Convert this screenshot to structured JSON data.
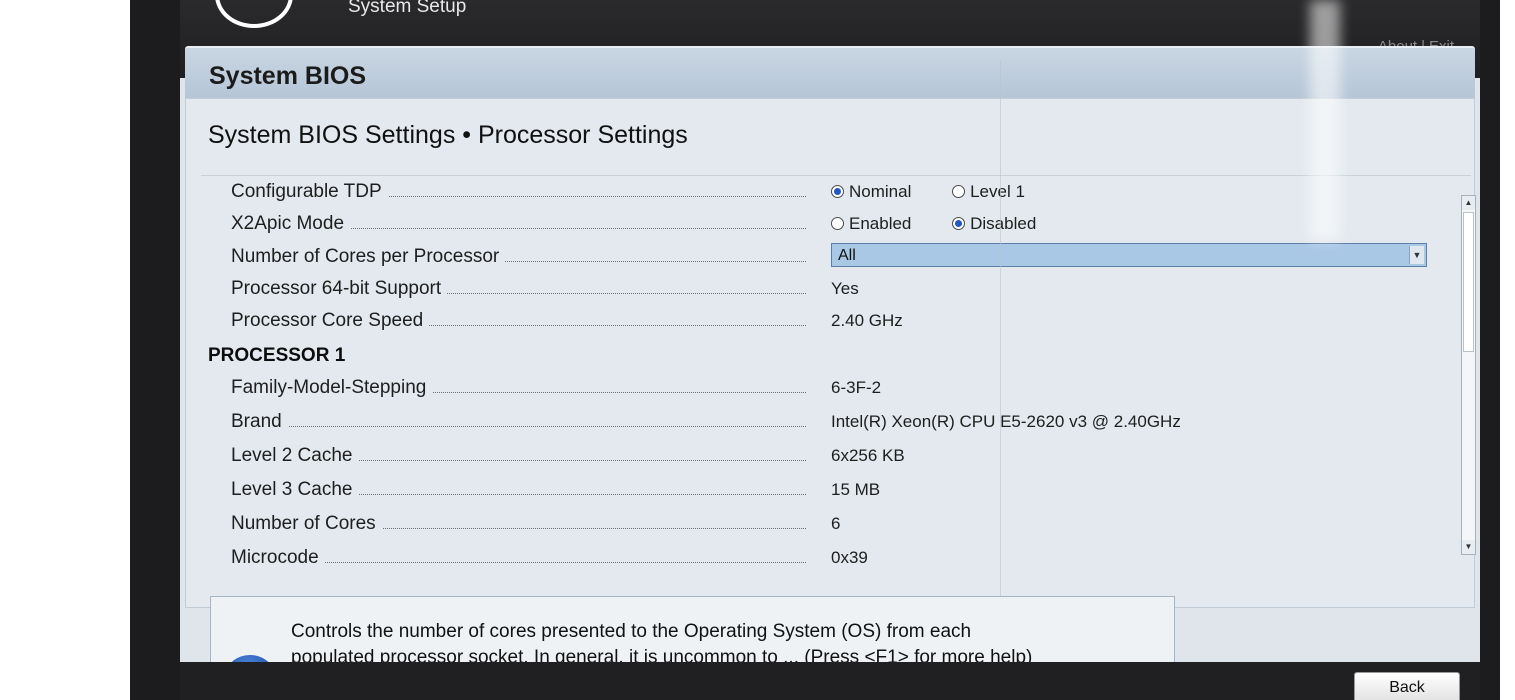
{
  "topbar": {
    "title": "System Setup",
    "about": "About",
    "separator": "|",
    "exit": "Exit"
  },
  "header": {
    "title": "System BIOS"
  },
  "page": {
    "title": "System BIOS Settings • Processor Settings"
  },
  "settings": {
    "configurable_tdp": {
      "label": "Configurable TDP",
      "options": [
        "Nominal",
        "Level 1"
      ],
      "selected": "Nominal"
    },
    "x2apic_mode": {
      "label": "X2Apic Mode",
      "options": [
        "Enabled",
        "Disabled"
      ],
      "selected": "Disabled"
    },
    "cores_per_processor": {
      "label": "Number of Cores per Processor",
      "value": "All"
    },
    "proc_64bit": {
      "label": "Processor 64-bit Support",
      "value": "Yes"
    },
    "core_speed": {
      "label": "Processor Core Speed",
      "value": "2.40 GHz"
    }
  },
  "processor1": {
    "heading": "PROCESSOR 1",
    "rows": [
      {
        "label": "Family-Model-Stepping",
        "value": "6-3F-2"
      },
      {
        "label": "Brand",
        "value": "Intel(R) Xeon(R) CPU E5-2620 v3 @ 2.40GHz"
      },
      {
        "label": "Level 2 Cache",
        "value": "6x256 KB"
      },
      {
        "label": "Level 3 Cache",
        "value": "15 MB"
      },
      {
        "label": "Number of Cores",
        "value": "6"
      },
      {
        "label": "Microcode",
        "value": "0x39"
      }
    ]
  },
  "help": {
    "line1": "Controls the number of cores presented to the Operating System (OS) from each",
    "line2": "populated processor socket. In general, it is uncommon to ... (Press <F1> for more help)"
  },
  "footer": {
    "back_label": "Back"
  }
}
